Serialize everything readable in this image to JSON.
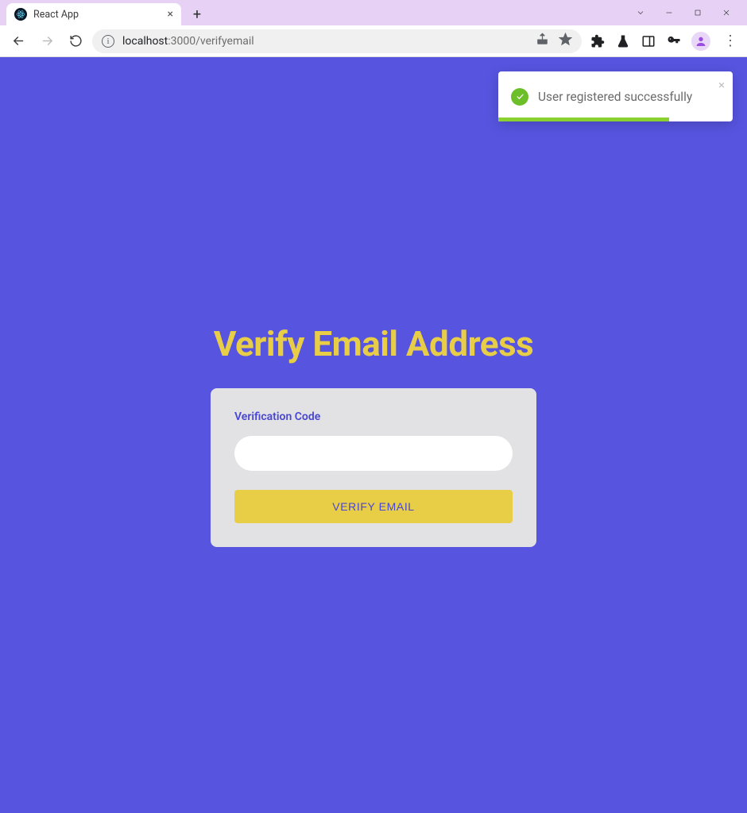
{
  "browser": {
    "tab_title": "React App",
    "url_host": "localhost",
    "url_port_path": ":3000/verifyemail"
  },
  "toast": {
    "message": "User registered successfully"
  },
  "page": {
    "title": "Verify Email Address",
    "field_label": "Verification Code",
    "code_value": "",
    "button_label": "VERIFY EMAIL"
  }
}
